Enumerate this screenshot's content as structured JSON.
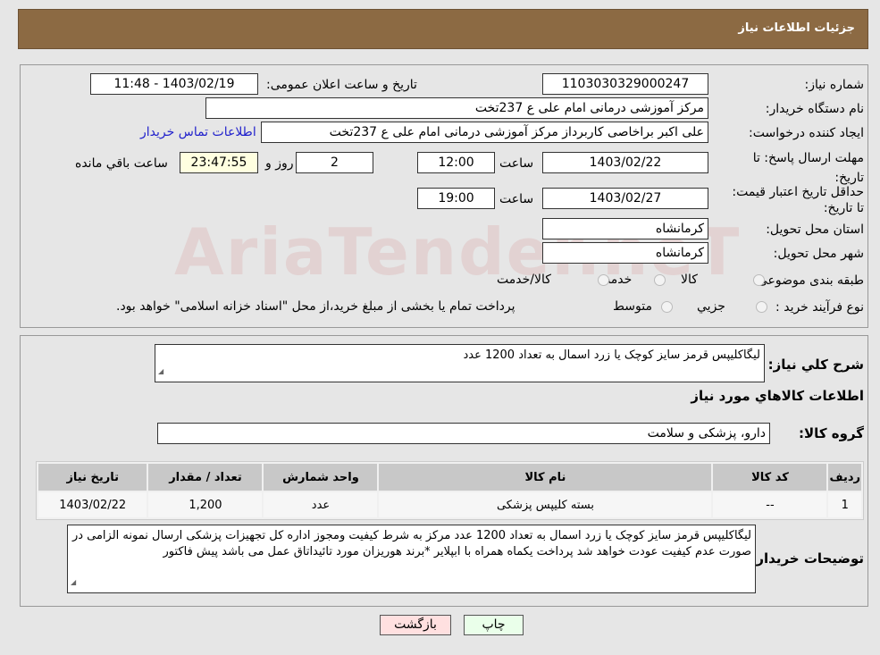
{
  "header": {
    "title": "جزئیات اطلاعات نیاز"
  },
  "fields": {
    "need_number_label": "شماره نیاز:",
    "need_number": "1103030329000247",
    "announce_label": "تاریخ و ساعت اعلان عمومی:",
    "announce_value": "1403/02/19 - 11:48",
    "buyer_org_label": "نام دستگاه خریدار:",
    "buyer_org": "مرکز آموزشی درمانی امام علی ع 237تخت",
    "creator_label": "ایجاد کننده درخواست:",
    "creator": "علی اکبر براخاصی کاربرداز  مرکز آموزشی درمانی امام علی ع 237تخت",
    "contact_link": "اطلاعات تماس خریدار",
    "deadline_label": "مهلت ارسال پاسخ: تا تاریخ:",
    "deadline_date": "1403/02/22",
    "time_label": "ساعت",
    "deadline_time": "12:00",
    "days": "2",
    "days_label": "روز و",
    "remaining": "23:47:55",
    "remaining_label": "ساعت باقي مانده",
    "validity_label": "حداقل تاریخ اعتبار قیمت: تا تاریخ:",
    "validity_date": "1403/02/27",
    "validity_time": "19:00",
    "province_label": "استان محل تحویل:",
    "province": "کرمانشاه",
    "city_label": "شهر محل تحویل:",
    "city": "کرمانشاه",
    "category_label": "طبقه بندی موضوعی:",
    "category_options": [
      "کالا",
      "خدمت",
      "کالا/خدمت"
    ],
    "process_label": "نوع فرآیند خرید :",
    "process_options": [
      "جزيي",
      "متوسط"
    ],
    "process_note": "پرداخت تمام یا بخشی از مبلغ خرید،از محل \"اسناد خزانه اسلامی\" خواهد بود."
  },
  "watermark": "AriaTender.neT",
  "description": {
    "label": "شرح کلي نياز:",
    "value": "لیگاکلیپس قرمز سایز کوچک  یا زرد اسمال به تعداد 1200 عدد"
  },
  "goods_title": "اطلاعات کالاهاي مورد نياز",
  "goods_group": {
    "label": "گروه کالا:",
    "value": "دارو، پزشکی و سلامت"
  },
  "table": {
    "headers": [
      "رديف",
      "کد کالا",
      "نام کالا",
      "واحد شمارش",
      "تعداد / مقدار",
      "تاریخ نیاز"
    ],
    "rows": [
      [
        "1",
        "--",
        "بسته کلیپس پزشکی",
        "عدد",
        "1,200",
        "1403/02/22"
      ]
    ]
  },
  "buyer_notes": {
    "label": "توضیحات خریدار:",
    "value": "لیگاکلیپس قرمز سایز کوچک  یا زرد اسمال به تعداد 1200 عدد   مرکز به شرط کیفیت ومجوز اداره کل تجهیزات پزشکی ارسال نمونه الزامی در صورت عدم کیفیت عودت خواهد شد پرداخت یکماه همراه با ابپلایر *برند هوریزان مورد تائیداتاق عمل می باشد پیش فاکتور"
  },
  "buttons": {
    "print": "چاپ",
    "back": "بازگشت"
  },
  "colors": {
    "header": "#8c6a43",
    "link": "#2222cc",
    "print_bg": "#eaffea",
    "back_bg": "#ffe0e0"
  }
}
